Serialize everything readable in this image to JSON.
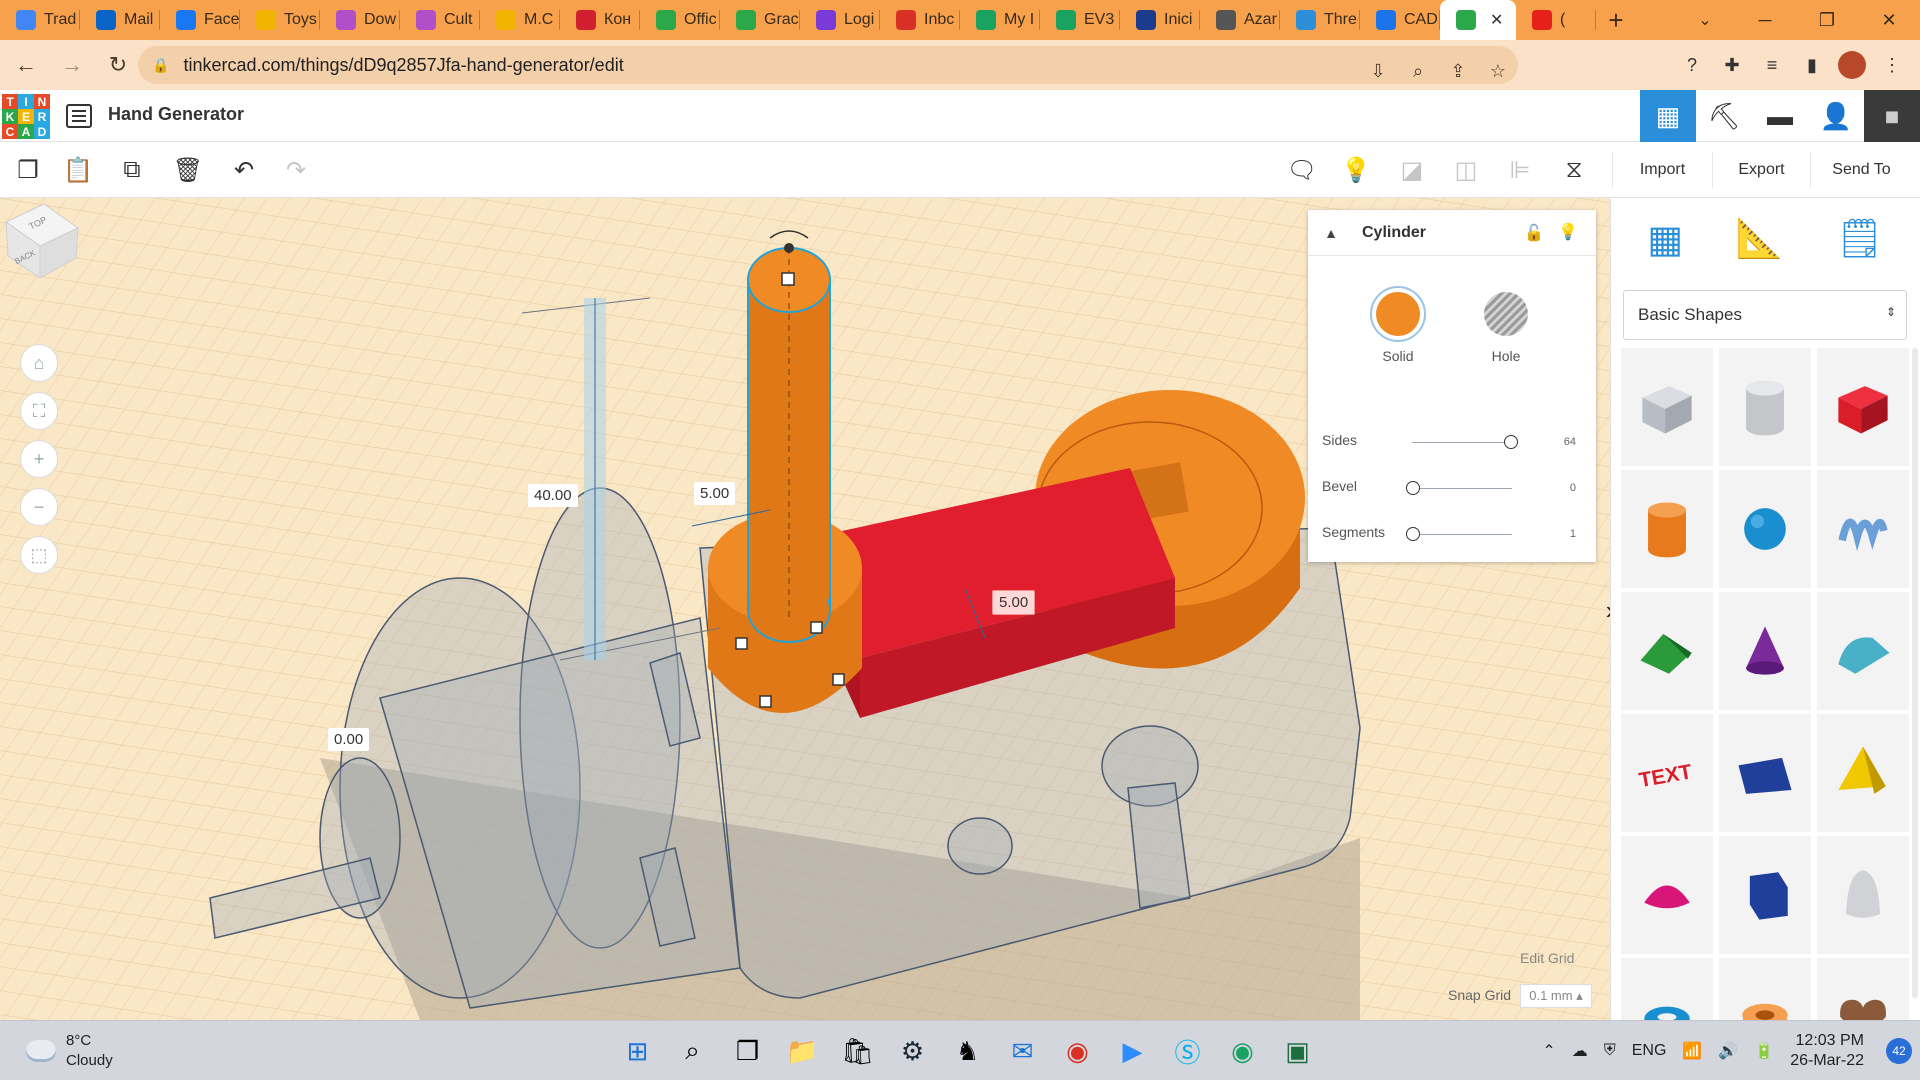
{
  "browser": {
    "tabs": [
      {
        "label": "Trad",
        "icon": "google-translate-icon",
        "color": "#4285f4"
      },
      {
        "label": "Mail",
        "icon": "outlook-icon",
        "color": "#0a64c8"
      },
      {
        "label": "Face",
        "icon": "facebook-icon",
        "color": "#1877f2"
      },
      {
        "label": "Toys",
        "icon": "emoji-icon",
        "color": "#f0b400"
      },
      {
        "label": "Dow",
        "icon": "link-icon",
        "color": "#b04fc8"
      },
      {
        "label": "Cult",
        "icon": "link-icon",
        "color": "#b04fc8"
      },
      {
        "label": "M.C",
        "icon": "emoji-icon",
        "color": "#f0b400"
      },
      {
        "label": "Кон",
        "icon": "video-icon",
        "color": "#d02030"
      },
      {
        "label": "Offic",
        "icon": "tinkercad-icon",
        "color": "#2aa84a"
      },
      {
        "label": "Grac",
        "icon": "tinkercad-icon",
        "color": "#2aa84a"
      },
      {
        "label": "Logi",
        "icon": "purple-logo-icon",
        "color": "#7a3ad8"
      },
      {
        "label": "Inbc",
        "icon": "gmail-icon",
        "color": "#d93025"
      },
      {
        "label": "My I",
        "icon": "drive-icon",
        "color": "#1aa260"
      },
      {
        "label": "EV3",
        "icon": "drive-icon",
        "color": "#1aa260"
      },
      {
        "label": "Inici",
        "icon": "paypal-icon",
        "color": "#1b3c8c"
      },
      {
        "label": "Azar",
        "icon": "wikipedia-icon",
        "color": "#555555"
      },
      {
        "label": "Thre",
        "icon": "thread-icon",
        "color": "#2a8fd8"
      },
      {
        "label": "CAD",
        "icon": "cad-icon",
        "color": "#1a73e8"
      },
      {
        "label": "",
        "icon": "tinkercad-icon",
        "color": "#2aa84a"
      },
      {
        "label": "(",
        "icon": "youtube-icon",
        "color": "#e62117"
      }
    ],
    "close_symbol": "✕",
    "new_tab_symbol": "+",
    "url": "tinkercad.com/things/dD9q2857Jfa-hand-generator/edit"
  },
  "app": {
    "logo_letters": [
      "T",
      "I",
      "N",
      "K",
      "E",
      "R",
      "C",
      "A",
      "D"
    ],
    "logo_colors": [
      "#e74a28",
      "#2aa8e0",
      "#e74a28",
      "#2aa84a",
      "#f5b400",
      "#2aa8e0",
      "#e74a28",
      "#2aa84a",
      "#2aa8e0"
    ],
    "design_title": "Hand Generator"
  },
  "toolbar": {
    "import_label": "Import",
    "export_label": "Export",
    "send_to_label": "Send To"
  },
  "viewcube": {
    "top_label": "TOP",
    "back_label": "BACK"
  },
  "dimensions": {
    "height": "40.00",
    "width": "5.00",
    "length": "5.00",
    "elevation": "0.00"
  },
  "inspector": {
    "shape_name": "Cylinder",
    "solid_label": "Solid",
    "hole_label": "Hole",
    "solid_color": "#f08a24",
    "props": [
      {
        "label": "Sides",
        "value": "64",
        "level": 1.0
      },
      {
        "label": "Bevel",
        "value": "0",
        "level": 0.0
      },
      {
        "label": "Segments",
        "value": "1",
        "level": 0.0
      }
    ]
  },
  "shapes_panel": {
    "library": "Basic Shapes",
    "shapes": [
      {
        "name": "box-hole-shape",
        "color": "#b8bcc4"
      },
      {
        "name": "cylinder-hole-shape",
        "color": "#c4c6ca"
      },
      {
        "name": "box-shape",
        "color": "#d91e2a"
      },
      {
        "name": "cylinder-shape",
        "color": "#e87a1e"
      },
      {
        "name": "sphere-shape",
        "color": "#1a8fcf"
      },
      {
        "name": "scribble-shape",
        "color": "#6a9fd8"
      },
      {
        "name": "roof-shape",
        "color": "#2a9a3a"
      },
      {
        "name": "cone-shape",
        "color": "#7a2a9a"
      },
      {
        "name": "round-roof-shape",
        "color": "#4ab0c8"
      },
      {
        "name": "text-shape",
        "color": "#d91e2a"
      },
      {
        "name": "wedge-shape",
        "color": "#203f9a"
      },
      {
        "name": "pyramid-shape",
        "color": "#f0c800"
      },
      {
        "name": "half-sphere-shape",
        "color": "#d8167a"
      },
      {
        "name": "polygon-shape",
        "color": "#203f9a"
      },
      {
        "name": "paraboloid-shape",
        "color": "#d0d2d6"
      },
      {
        "name": "torus-shape",
        "color": "#1a8fcf"
      },
      {
        "name": "tube-shape",
        "color": "#e87a1e"
      },
      {
        "name": "heart-shape",
        "color": "#8a5a3a"
      }
    ]
  },
  "grid": {
    "edit_grid_label": "Edit Grid",
    "snap_grid_label": "Snap Grid",
    "snap_value": "0.1 mm ▴"
  },
  "taskbar": {
    "temperature": "8°C",
    "condition": "Cloudy",
    "language": "ENG",
    "time": "12:03 PM",
    "date": "26-Mar-22",
    "notifications": "42"
  },
  "colors": {
    "accent": "#2a8fd8",
    "workplane_bg": "#f9e7c6",
    "grid_line": "#e8c696",
    "selection_outline": "#1fa4d8"
  }
}
